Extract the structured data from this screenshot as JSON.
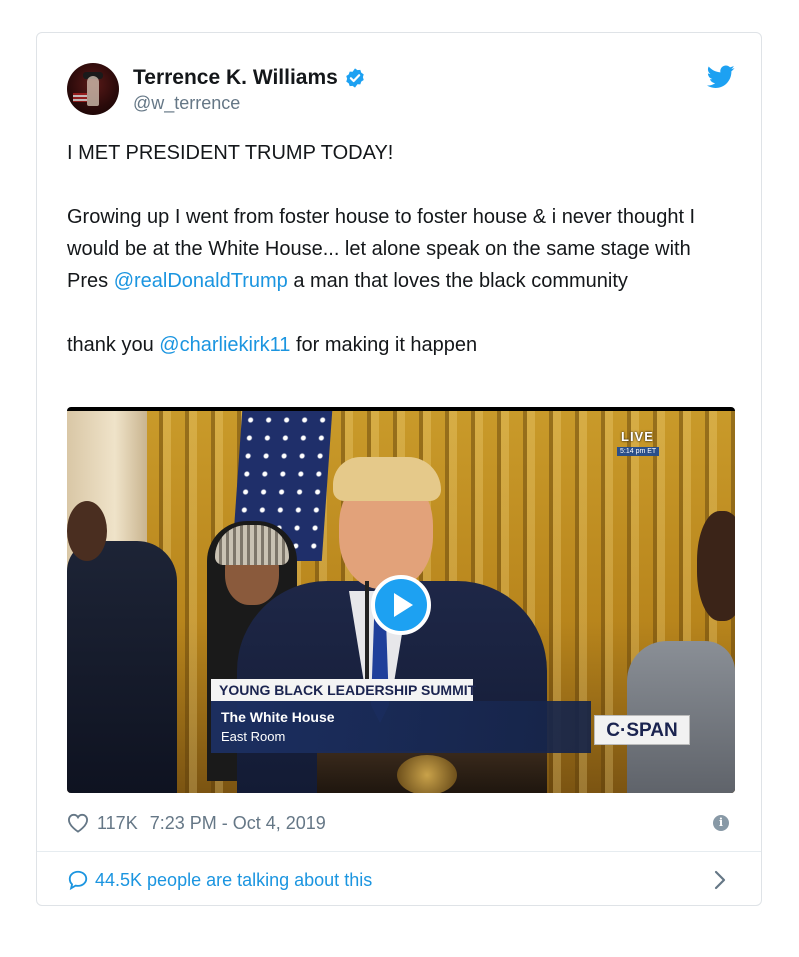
{
  "tweet": {
    "author_name": "Terrence K. Williams",
    "author_handle": "@w_terrence",
    "line1": "I MET PRESIDENT TRUMP TODAY!",
    "para2_a": "Growing up I went from foster house to foster house & i never thought I would be at the White House... let alone speak on the same stage with Pres ",
    "mention1": "@realDonaldTrump",
    "para2_b": " a man that loves the black community",
    "para3_a": "thank you ",
    "mention2": "@charliekirk11",
    "para3_b": " for making it happen",
    "likes": "117K",
    "timestamp": "7:23 PM - Oct 4, 2019",
    "talking": "44.5K people are talking about this"
  },
  "video": {
    "live_label": "LIVE",
    "live_time": "5:14 pm ET",
    "lower_title": "YOUNG BLACK LEADERSHIP SUMMIT",
    "lower_line1": "The White House",
    "lower_line2": "East Room",
    "network": "C·SPAN"
  },
  "icons": {
    "verified": "verified-badge-icon",
    "twitter": "twitter-bird-icon",
    "play": "play-icon",
    "heart": "heart-icon",
    "info": "info-icon",
    "reply": "speech-bubble-icon",
    "chevron": "chevron-right-icon"
  },
  "colors": {
    "brand_blue": "#1da1f2",
    "link_blue": "#1b95e0",
    "muted": "#657786"
  }
}
